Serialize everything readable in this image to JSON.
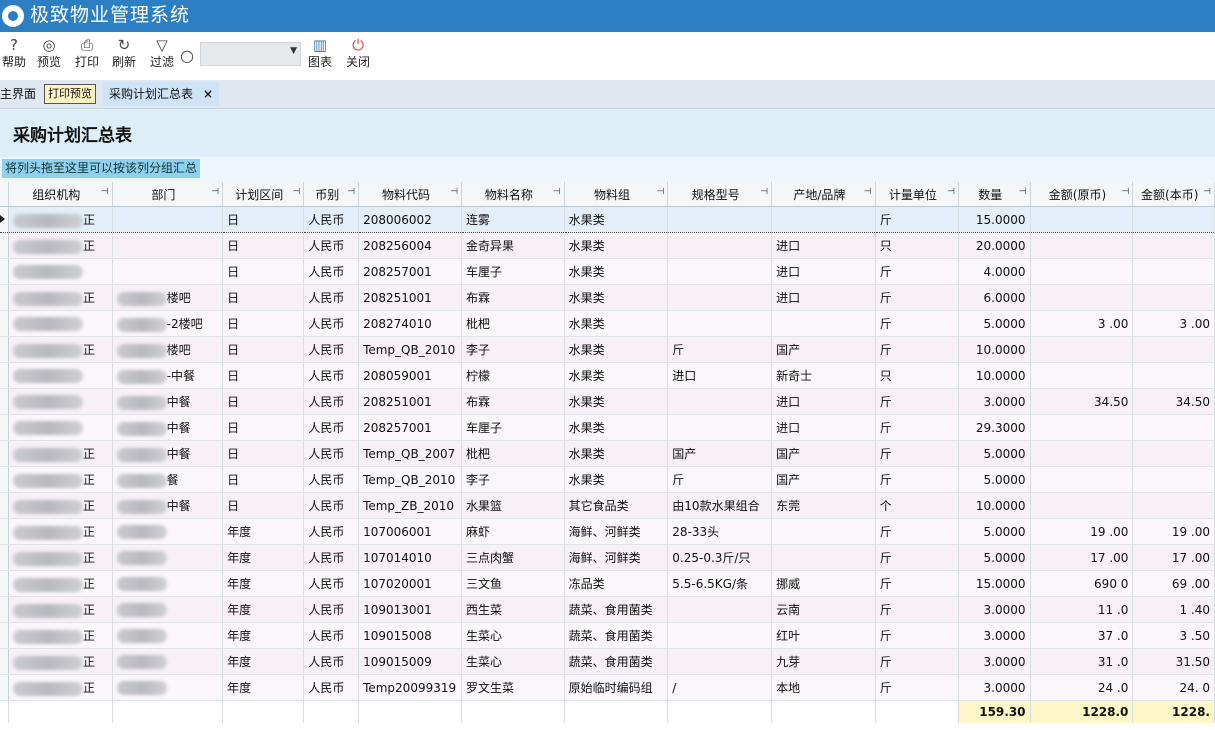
{
  "app": {
    "title": "极致物业管理系统"
  },
  "toolbar": {
    "help": "帮助",
    "preview": "预览",
    "print": "打印",
    "refresh": "刷新",
    "filter": "过滤",
    "search_value": "",
    "chart": "图表",
    "close": "关闭"
  },
  "tabs": {
    "home": "主界面",
    "print_preview": "打印预览",
    "active": "采购计划汇总表",
    "close_glyph": "×"
  },
  "report": {
    "title": "采购计划汇总表",
    "group_hint": "将列头拖至这里可以按该列分组汇总"
  },
  "columns": [
    "组织机构",
    "部门",
    "计划区间",
    "币别",
    "物料代码",
    "物料名称",
    "物料组",
    "规格型号",
    "产地/品牌",
    "计量单位",
    "数量",
    "金额(原币)",
    "金额(本币)"
  ],
  "rows": [
    {
      "org": "正",
      "dept": "",
      "period": "日",
      "currency": "人民币",
      "code": "208006002",
      "name": "连雾",
      "group": "水果类",
      "spec": "",
      "origin": "",
      "unit": "斤",
      "qty": "15.0000",
      "amt": "",
      "amt_local": ""
    },
    {
      "org": "正",
      "dept": "",
      "period": "日",
      "currency": "人民币",
      "code": "208256004",
      "name": "金奇异果",
      "group": "水果类",
      "spec": "",
      "origin": "进口",
      "unit": "只",
      "qty": "20.0000",
      "amt": "",
      "amt_local": ""
    },
    {
      "org": "",
      "dept": "",
      "period": "日",
      "currency": "人民币",
      "code": "208257001",
      "name": "车厘子",
      "group": "水果类",
      "spec": "",
      "origin": "进口",
      "unit": "斤",
      "qty": "4.0000",
      "amt": "",
      "amt_local": ""
    },
    {
      "org": "正",
      "dept": "楼吧",
      "period": "日",
      "currency": "人民币",
      "code": "208251001",
      "name": "布霖",
      "group": "水果类",
      "spec": "",
      "origin": "进口",
      "unit": "斤",
      "qty": "6.0000",
      "amt": "",
      "amt_local": ""
    },
    {
      "org": "",
      "dept": "-2楼吧",
      "period": "日",
      "currency": "人民币",
      "code": "208274010",
      "name": "枇杷",
      "group": "水果类",
      "spec": "",
      "origin": "",
      "unit": "斤",
      "qty": "5.0000",
      "amt": "3 .00",
      "amt_local": "3 .00"
    },
    {
      "org": "正",
      "dept": "楼吧",
      "period": "日",
      "currency": "人民币",
      "code": "Temp_QB_2010",
      "name": "李子",
      "group": "水果类",
      "spec": "斤",
      "origin": "国产",
      "unit": "斤",
      "qty": "10.0000",
      "amt": "",
      "amt_local": ""
    },
    {
      "org": "",
      "dept": "-中餐",
      "period": "日",
      "currency": "人民币",
      "code": "208059001",
      "name": "柠檬",
      "group": "水果类",
      "spec": "进口",
      "origin": "新奇士",
      "unit": "只",
      "qty": "10.0000",
      "amt": "",
      "amt_local": ""
    },
    {
      "org": "",
      "dept": "中餐",
      "period": "日",
      "currency": "人民币",
      "code": "208251001",
      "name": "布霖",
      "group": "水果类",
      "spec": "",
      "origin": "进口",
      "unit": "斤",
      "qty": "3.0000",
      "amt": "34.50",
      "amt_local": "34.50"
    },
    {
      "org": "",
      "dept": "中餐",
      "period": "日",
      "currency": "人民币",
      "code": "208257001",
      "name": "车厘子",
      "group": "水果类",
      "spec": "",
      "origin": "进口",
      "unit": "斤",
      "qty": "29.3000",
      "amt": "",
      "amt_local": ""
    },
    {
      "org": "正",
      "dept": "中餐",
      "period": "日",
      "currency": "人民币",
      "code": "Temp_QB_2007",
      "name": "枇杷",
      "group": "水果类",
      "spec": "国产",
      "origin": "国产",
      "unit": "斤",
      "qty": "5.0000",
      "amt": "",
      "amt_local": ""
    },
    {
      "org": "正",
      "dept": "餐",
      "period": "日",
      "currency": "人民币",
      "code": "Temp_QB_2010",
      "name": "李子",
      "group": "水果类",
      "spec": "斤",
      "origin": "国产",
      "unit": "斤",
      "qty": "5.0000",
      "amt": "",
      "amt_local": ""
    },
    {
      "org": "正",
      "dept": "中餐",
      "period": "日",
      "currency": "人民币",
      "code": "Temp_ZB_2010",
      "name": "水果篮",
      "group": "其它食品类",
      "spec": "由10款水果组合",
      "origin": "东莞",
      "unit": "个",
      "qty": "10.0000",
      "amt": "",
      "amt_local": ""
    },
    {
      "org": "正",
      "dept": "",
      "period": "年度",
      "currency": "人民币",
      "code": "107006001",
      "name": "麻虾",
      "group": "海鲜、河鲜类",
      "spec": "28-33头",
      "origin": "",
      "unit": "斤",
      "qty": "5.0000",
      "amt": "19 .00",
      "amt_local": "19 .00"
    },
    {
      "org": "正",
      "dept": "",
      "period": "年度",
      "currency": "人民币",
      "code": "107014010",
      "name": "三点肉蟹",
      "group": "海鲜、河鲜类",
      "spec": "0.25-0.3斤/只",
      "origin": "",
      "unit": "斤",
      "qty": "5.0000",
      "amt": "17 .00",
      "amt_local": "17 .00"
    },
    {
      "org": "正",
      "dept": "",
      "period": "年度",
      "currency": "人民币",
      "code": "107020001",
      "name": "三文鱼",
      "group": "冻品类",
      "spec": "5.5-6.5KG/条",
      "origin": "挪威",
      "unit": "斤",
      "qty": "15.0000",
      "amt": "690 0",
      "amt_local": "69 .00"
    },
    {
      "org": "正",
      "dept": "",
      "period": "年度",
      "currency": "人民币",
      "code": "109013001",
      "name": "西生菜",
      "group": "蔬菜、食用菌类",
      "spec": "",
      "origin": "云南",
      "unit": "斤",
      "qty": "3.0000",
      "amt": "11 .0",
      "amt_local": "1 .40"
    },
    {
      "org": "正",
      "dept": "",
      "period": "年度",
      "currency": "人民币",
      "code": "109015008",
      "name": "生菜心",
      "group": "蔬菜、食用菌类",
      "spec": "",
      "origin": "红叶",
      "unit": "斤",
      "qty": "3.0000",
      "amt": "37 .0",
      "amt_local": "3 .50"
    },
    {
      "org": "正",
      "dept": "",
      "period": "年度",
      "currency": "人民币",
      "code": "109015009",
      "name": "生菜心",
      "group": "蔬菜、食用菌类",
      "spec": "",
      "origin": "九芽",
      "unit": "斤",
      "qty": "3.0000",
      "amt": "31 .0",
      "amt_local": "31.50"
    },
    {
      "org": "正",
      "dept": "",
      "period": "年度",
      "currency": "人民币",
      "code": "Temp20099319",
      "name": "罗文生菜",
      "group": "原始临时编码组",
      "spec": "/",
      "origin": "本地",
      "unit": "斤",
      "qty": "3.0000",
      "amt": "24 .0",
      "amt_local": "24. 0"
    }
  ],
  "totals": {
    "qty": "159.30",
    "amt": "1228.0",
    "amt_local": "1228."
  }
}
